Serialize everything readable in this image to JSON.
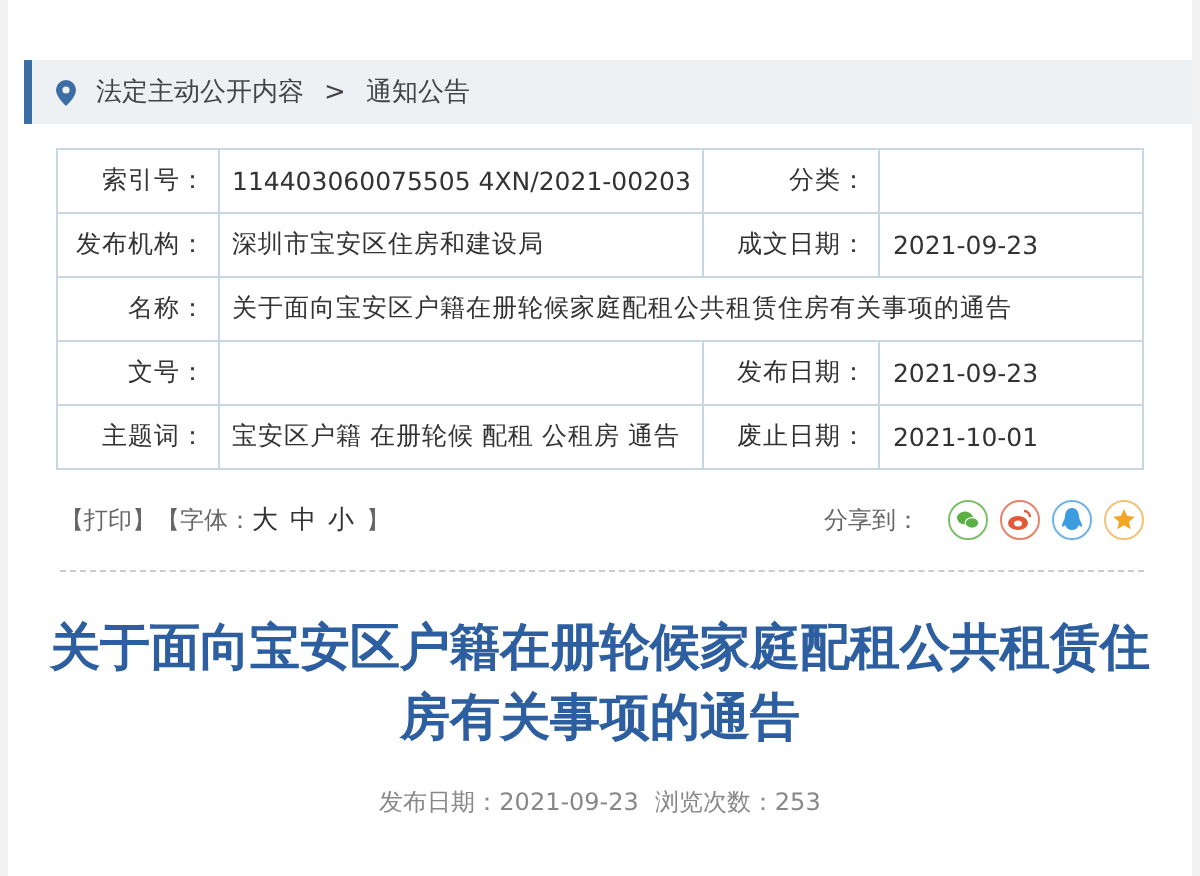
{
  "breadcrumb": {
    "items": [
      "法定主动公开内容",
      "通知公告"
    ],
    "separator": ">"
  },
  "info_table": {
    "rows": [
      {
        "kind": "pair",
        "label": "索引号：",
        "value": "114403060075505 4XN/2021-00203",
        "label_2": "分类："
      },
      {
        "kind": "pair",
        "label": "发布机构：",
        "value": "深圳市宝安区住房和建设局",
        "label_2": "成文日期：",
        "value_2": "2021-09-23"
      },
      {
        "kind": "full",
        "label": "名称：",
        "value": "关于面向宝安区户籍在册轮候家庭配租公共租赁住房有关事项的通告"
      },
      {
        "kind": "pair",
        "label": "文号：",
        "label_2": "发布日期：",
        "value_2": "2021-09-23"
      },
      {
        "kind": "pair",
        "label": "主题词：",
        "value": "宝安区户籍 在册轮候 配租 公租房 通告",
        "label_2": "废止日期：",
        "value_2": "2021-10-01"
      }
    ]
  },
  "toolbar": {
    "print": "【打印】",
    "font_label": "【字体：",
    "font_sizes": [
      "大",
      "中",
      "小"
    ],
    "font_close": "】",
    "share_label": "分享到："
  },
  "article": {
    "title": "关于面向宝安区户籍在册轮候家庭配租公共租赁住房有关事项的通告",
    "date": "发布日期：2021-09-23",
    "views": "浏览次数：253"
  }
}
